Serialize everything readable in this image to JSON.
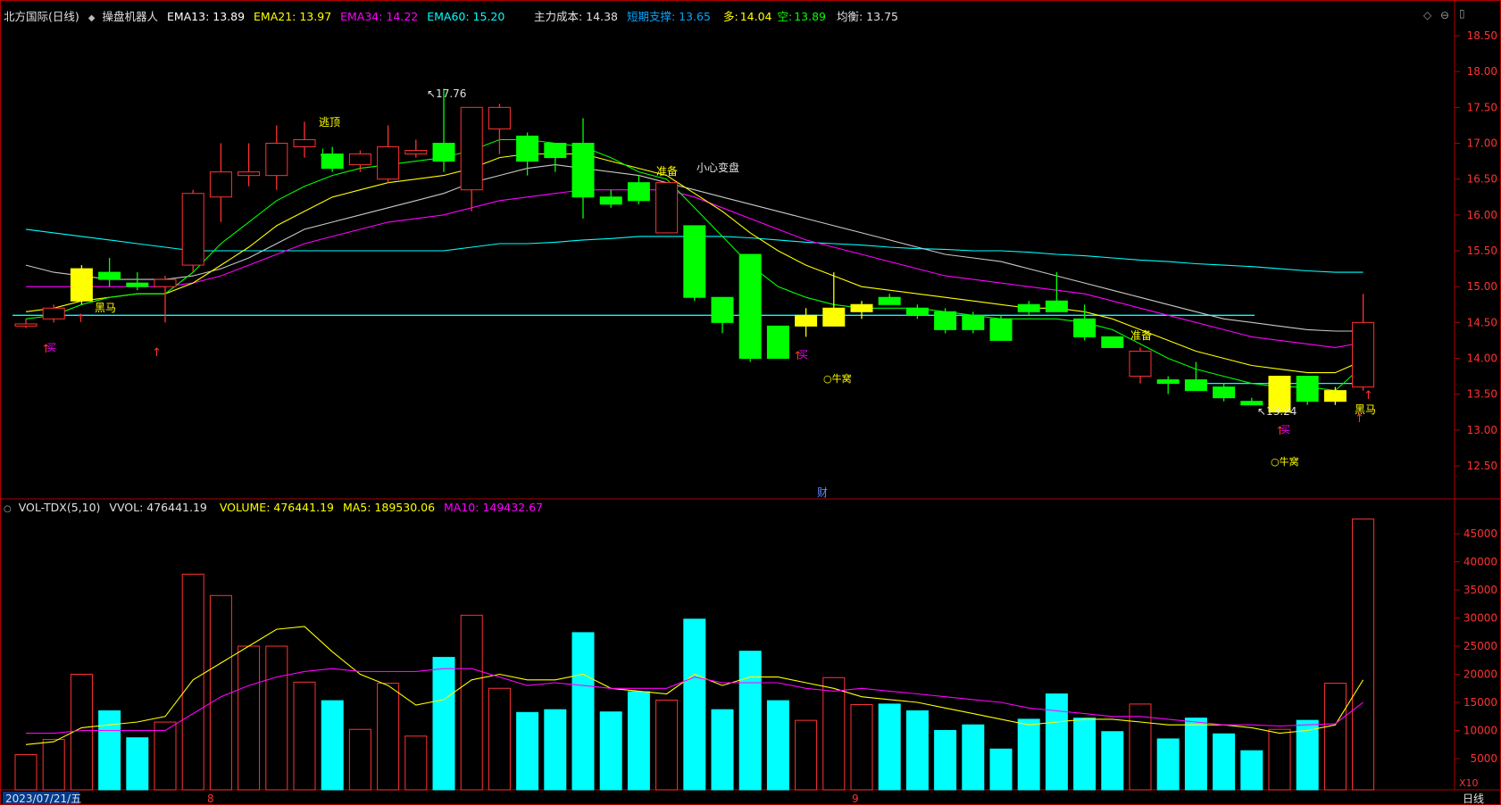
{
  "header_main": {
    "stock": "北方国际(日线)",
    "indicator": "操盘机器人",
    "ema13": "EMA13: 13.89",
    "ema21": "EMA21: 13.97",
    "ema34": "EMA34: 14.22",
    "ema60": "EMA60: 15.20",
    "cost": "主力成本: 14.38",
    "support": "短期支撑: 13.65",
    "duo_label": "多:",
    "duo_val": "14.04",
    "kong_label": "空:",
    "kong_val": "13.89",
    "balance": "均衡: 13.75"
  },
  "header_vol": {
    "name": "VOL-TDX(5,10)",
    "vvol": "VVOL: 476441.19",
    "volume": "VOLUME: 476441.19",
    "ma5": "MA5: 189530.06",
    "ma10": "MA10: 149432.67"
  },
  "colors": {
    "up": "#ff3232",
    "down": "#00ff00",
    "yellow_box": "#ffff00",
    "vol_up": "#ff3232",
    "vol_down": "#00ffff",
    "ema13": "#ffffff",
    "ema21": "#ffff00",
    "ema34": "#ff00ff",
    "ema60": "#00ffff",
    "cost": "#00a6ff",
    "axis": "#b00000"
  },
  "price_axis": [
    "18.50",
    "18.00",
    "17.50",
    "17.00",
    "16.50",
    "16.00",
    "15.50",
    "15.00",
    "14.50",
    "14.00",
    "13.50",
    "13.00",
    "12.50"
  ],
  "vol_axis": [
    "45000",
    "40000",
    "35000",
    "30000",
    "25000",
    "20000",
    "15000",
    "10000",
    "5000"
  ],
  "vol_unit": "X10",
  "date_axis": {
    "start": "2023/07/21/五",
    "m8": "8",
    "m9": "9",
    "period": "日线"
  },
  "annotations": {
    "high": "17.76",
    "low": "13.24",
    "escape_top": "逃顶",
    "heima": "黑马",
    "buy": "买",
    "prepare": "准备",
    "careful": "小心变盘",
    "niuwo": "牛窝",
    "cai": "财"
  },
  "chart_data": {
    "type": "candlestick",
    "candles": [
      {
        "o": 14.45,
        "h": 14.55,
        "l": 14.42,
        "c": 14.48,
        "v": 5700,
        "s": "hollow-up"
      },
      {
        "o": 14.55,
        "h": 14.75,
        "l": 14.5,
        "c": 14.7,
        "v": 8400,
        "s": "hollow-up"
      },
      {
        "o": 14.8,
        "h": 15.3,
        "l": 14.75,
        "c": 15.25,
        "v": 20000,
        "s": "yellow"
      },
      {
        "o": 15.1,
        "h": 15.4,
        "l": 15.0,
        "c": 15.2,
        "v": 13500,
        "s": "down"
      },
      {
        "o": 15.0,
        "h": 15.2,
        "l": 14.95,
        "c": 15.05,
        "v": 8700,
        "s": "down"
      },
      {
        "o": 15.0,
        "h": 15.15,
        "l": 14.5,
        "c": 15.1,
        "v": 11500,
        "s": "hollow-up"
      },
      {
        "o": 15.3,
        "h": 16.35,
        "l": 15.2,
        "c": 16.3,
        "v": 37800,
        "s": "hollow-up"
      },
      {
        "o": 16.25,
        "h": 17.0,
        "l": 15.9,
        "c": 16.6,
        "v": 34000,
        "s": "hollow-up"
      },
      {
        "o": 16.55,
        "h": 17.0,
        "l": 16.4,
        "c": 16.6,
        "v": 25000,
        "s": "hollow-up"
      },
      {
        "o": 16.55,
        "h": 17.25,
        "l": 16.35,
        "c": 17.0,
        "v": 25000,
        "s": "hollow-up"
      },
      {
        "o": 16.95,
        "h": 17.3,
        "l": 16.8,
        "c": 17.05,
        "v": 18600,
        "s": "hollow-up"
      },
      {
        "o": 16.85,
        "h": 16.95,
        "l": 16.6,
        "c": 16.65,
        "v": 15300,
        "s": "down"
      },
      {
        "o": 16.7,
        "h": 16.9,
        "l": 16.6,
        "c": 16.85,
        "v": 10200,
        "s": "hollow-up"
      },
      {
        "o": 16.5,
        "h": 17.25,
        "l": 16.45,
        "c": 16.95,
        "v": 18400,
        "s": "hollow-up"
      },
      {
        "o": 16.9,
        "h": 17.05,
        "l": 16.8,
        "c": 16.85,
        "v": 9000,
        "s": "hollow-up"
      },
      {
        "o": 16.75,
        "h": 17.76,
        "l": 16.6,
        "c": 17.0,
        "v": 23000,
        "s": "down"
      },
      {
        "o": 16.35,
        "h": 17.5,
        "l": 16.05,
        "c": 17.5,
        "v": 30500,
        "s": "hollow-up"
      },
      {
        "o": 17.2,
        "h": 17.55,
        "l": 16.85,
        "c": 17.5,
        "v": 17500,
        "s": "hollow-up"
      },
      {
        "o": 17.1,
        "h": 17.15,
        "l": 16.55,
        "c": 16.75,
        "v": 13200,
        "s": "down"
      },
      {
        "o": 17.0,
        "h": 17.0,
        "l": 16.6,
        "c": 16.8,
        "v": 13700,
        "s": "down"
      },
      {
        "o": 17.0,
        "h": 17.35,
        "l": 15.95,
        "c": 16.25,
        "v": 27400,
        "s": "down"
      },
      {
        "o": 16.25,
        "h": 16.35,
        "l": 16.1,
        "c": 16.15,
        "v": 13300,
        "s": "down"
      },
      {
        "o": 16.45,
        "h": 16.55,
        "l": 16.15,
        "c": 16.2,
        "v": 16900,
        "s": "down"
      },
      {
        "o": 15.75,
        "h": 16.45,
        "l": 15.75,
        "c": 16.45,
        "v": 15400,
        "s": "hollow-up"
      },
      {
        "o": 15.85,
        "h": 15.85,
        "l": 14.8,
        "c": 14.85,
        "v": 29800,
        "s": "down"
      },
      {
        "o": 14.85,
        "h": 14.85,
        "l": 14.35,
        "c": 14.5,
        "v": 13700,
        "s": "down"
      },
      {
        "o": 15.45,
        "h": 15.45,
        "l": 13.95,
        "c": 14.0,
        "v": 24100,
        "s": "down"
      },
      {
        "o": 14.45,
        "h": 14.45,
        "l": 14.0,
        "c": 14.0,
        "v": 15300,
        "s": "down"
      },
      {
        "o": 14.45,
        "h": 14.7,
        "l": 14.3,
        "c": 14.6,
        "v": 11800,
        "s": "yellow"
      },
      {
        "o": 14.45,
        "h": 15.2,
        "l": 14.45,
        "c": 14.7,
        "v": 19400,
        "s": "yellow"
      },
      {
        "o": 14.65,
        "h": 14.8,
        "l": 14.55,
        "c": 14.75,
        "v": 14600,
        "s": "yellow"
      },
      {
        "o": 14.85,
        "h": 14.9,
        "l": 14.75,
        "c": 14.75,
        "v": 14700,
        "s": "down"
      },
      {
        "o": 14.7,
        "h": 14.75,
        "l": 14.55,
        "c": 14.6,
        "v": 13500,
        "s": "down"
      },
      {
        "o": 14.65,
        "h": 14.7,
        "l": 14.35,
        "c": 14.4,
        "v": 10000,
        "s": "down"
      },
      {
        "o": 14.6,
        "h": 14.65,
        "l": 14.35,
        "c": 14.4,
        "v": 11000,
        "s": "down"
      },
      {
        "o": 14.55,
        "h": 14.6,
        "l": 14.25,
        "c": 14.25,
        "v": 6700,
        "s": "down"
      },
      {
        "o": 14.75,
        "h": 14.8,
        "l": 14.6,
        "c": 14.65,
        "v": 12000,
        "s": "down"
      },
      {
        "o": 14.8,
        "h": 15.2,
        "l": 14.65,
        "c": 14.65,
        "v": 16500,
        "s": "down"
      },
      {
        "o": 14.55,
        "h": 14.75,
        "l": 14.25,
        "c": 14.3,
        "v": 12200,
        "s": "down"
      },
      {
        "o": 14.3,
        "h": 14.3,
        "l": 14.15,
        "c": 14.15,
        "v": 9800,
        "s": "down"
      },
      {
        "o": 14.1,
        "h": 14.15,
        "l": 13.65,
        "c": 13.75,
        "v": 14700,
        "s": "hollow-up"
      },
      {
        "o": 13.7,
        "h": 13.75,
        "l": 13.5,
        "c": 13.65,
        "v": 8500,
        "s": "down"
      },
      {
        "o": 13.7,
        "h": 13.95,
        "l": 13.55,
        "c": 13.55,
        "v": 12200,
        "s": "down"
      },
      {
        "o": 13.6,
        "h": 13.65,
        "l": 13.4,
        "c": 13.45,
        "v": 9400,
        "s": "down"
      },
      {
        "o": 13.4,
        "h": 13.45,
        "l": 13.35,
        "c": 13.35,
        "v": 6400,
        "s": "down"
      },
      {
        "o": 13.25,
        "h": 13.75,
        "l": 13.24,
        "c": 13.75,
        "v": 10200,
        "s": "yellow"
      },
      {
        "o": 13.75,
        "h": 13.75,
        "l": 13.35,
        "c": 13.4,
        "v": 11800,
        "s": "down"
      },
      {
        "o": 13.55,
        "h": 13.6,
        "l": 13.35,
        "c": 13.4,
        "v": 18400,
        "s": "yellow"
      },
      {
        "o": 14.5,
        "h": 14.9,
        "l": 13.55,
        "c": 13.6,
        "v": 47600,
        "s": "hollow-up"
      }
    ],
    "ema13": [
      14.55,
      14.6,
      14.75,
      14.85,
      14.9,
      14.9,
      15.2,
      15.6,
      15.9,
      16.2,
      16.4,
      16.55,
      16.65,
      16.7,
      16.75,
      16.8,
      16.9,
      17.05,
      17.05,
      17.0,
      16.95,
      16.8,
      16.6,
      16.5,
      16.1,
      15.7,
      15.3,
      15.0,
      14.85,
      14.75,
      14.7,
      14.7,
      14.7,
      14.65,
      14.6,
      14.55,
      14.55,
      14.55,
      14.5,
      14.4,
      14.2,
      14.0,
      13.85,
      13.75,
      13.65,
      13.6,
      13.6,
      13.55,
      13.9
    ],
    "ema21": [
      14.65,
      14.7,
      14.8,
      14.85,
      14.9,
      14.9,
      15.05,
      15.3,
      15.55,
      15.85,
      16.05,
      16.25,
      16.35,
      16.45,
      16.5,
      16.55,
      16.65,
      16.8,
      16.85,
      16.85,
      16.85,
      16.75,
      16.65,
      16.55,
      16.3,
      16.05,
      15.75,
      15.5,
      15.3,
      15.15,
      15.0,
      14.95,
      14.9,
      14.85,
      14.8,
      14.75,
      14.7,
      14.7,
      14.65,
      14.55,
      14.4,
      14.25,
      14.1,
      14.0,
      13.9,
      13.85,
      13.8,
      13.8,
      13.97
    ],
    "ema34": [
      15.0,
      15.0,
      15.0,
      15.0,
      15.0,
      15.0,
      15.05,
      15.15,
      15.3,
      15.45,
      15.6,
      15.7,
      15.8,
      15.9,
      15.95,
      16.0,
      16.1,
      16.2,
      16.25,
      16.3,
      16.35,
      16.35,
      16.35,
      16.35,
      16.25,
      16.1,
      15.95,
      15.8,
      15.65,
      15.55,
      15.45,
      15.35,
      15.25,
      15.15,
      15.1,
      15.05,
      15.0,
      14.95,
      14.9,
      14.8,
      14.7,
      14.6,
      14.5,
      14.4,
      14.3,
      14.25,
      14.2,
      14.15,
      14.22
    ],
    "ema60": [
      15.8,
      15.75,
      15.7,
      15.65,
      15.6,
      15.55,
      15.5,
      15.5,
      15.5,
      15.5,
      15.5,
      15.5,
      15.5,
      15.5,
      15.5,
      15.5,
      15.55,
      15.6,
      15.6,
      15.62,
      15.65,
      15.67,
      15.7,
      15.7,
      15.7,
      15.7,
      15.68,
      15.65,
      15.62,
      15.6,
      15.58,
      15.55,
      15.53,
      15.52,
      15.5,
      15.5,
      15.48,
      15.45,
      15.43,
      15.4,
      15.37,
      15.35,
      15.32,
      15.3,
      15.28,
      15.25,
      15.22,
      15.2,
      15.2
    ],
    "cost": [
      15.3,
      15.2,
      15.15,
      15.1,
      15.1,
      15.1,
      15.15,
      15.25,
      15.4,
      15.6,
      15.8,
      15.9,
      16.0,
      16.1,
      16.2,
      16.3,
      16.45,
      16.55,
      16.65,
      16.7,
      16.65,
      16.6,
      16.55,
      16.45,
      16.35,
      16.25,
      16.15,
      16.05,
      15.95,
      15.85,
      15.75,
      15.65,
      15.55,
      15.45,
      15.4,
      15.35,
      15.25,
      15.15,
      15.05,
      14.95,
      14.85,
      14.75,
      14.65,
      14.55,
      14.5,
      14.45,
      14.4,
      14.38,
      14.38
    ],
    "support_line": 14.6,
    "support_line2": 13.65,
    "vol_ma5": [
      7500,
      8000,
      10500,
      11000,
      11500,
      12500,
      19000,
      22000,
      25000,
      28000,
      28500,
      24000,
      20000,
      18000,
      14500,
      15500,
      19000,
      20000,
      19000,
      19000,
      20000,
      17500,
      17000,
      16500,
      20000,
      18000,
      19500,
      19500,
      18500,
      17500,
      16000,
      15500,
      15000,
      14000,
      13000,
      12000,
      11000,
      11500,
      12000,
      12000,
      11500,
      11000,
      11000,
      11000,
      10500,
      9500,
      10000,
      11000,
      19000
    ],
    "vol_ma10": [
      9500,
      9500,
      10000,
      10000,
      10000,
      10000,
      13000,
      16000,
      18000,
      19500,
      20500,
      21000,
      20500,
      20500,
      20500,
      21000,
      21000,
      19500,
      18000,
      18500,
      18000,
      17500,
      17500,
      17500,
      19500,
      18500,
      18500,
      18500,
      17500,
      17000,
      17500,
      17000,
      16500,
      16000,
      15500,
      15000,
      14000,
      13500,
      13000,
      12500,
      12500,
      12000,
      11500,
      11000,
      11000,
      10800,
      11000,
      11200,
      15000
    ]
  }
}
